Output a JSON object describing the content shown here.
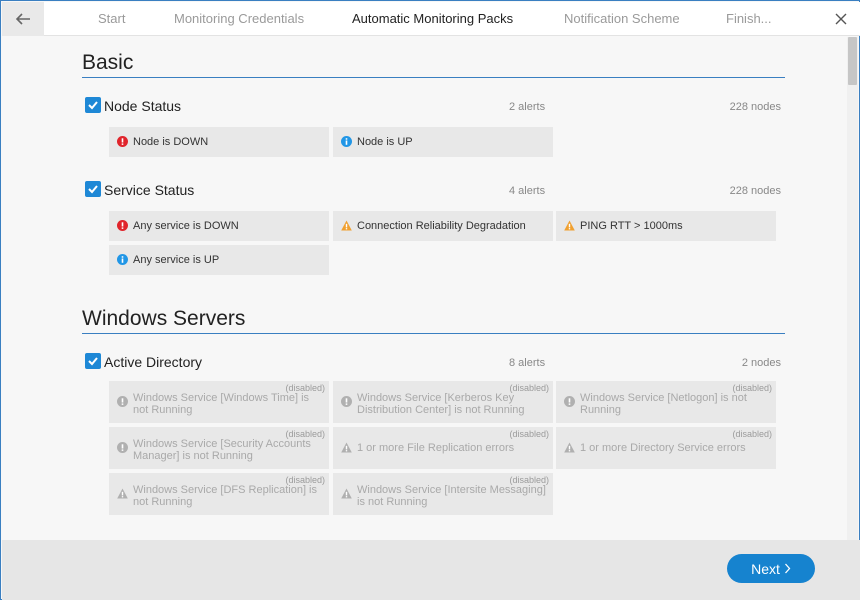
{
  "wizard": {
    "steps": [
      {
        "label": "Start"
      },
      {
        "label": "Monitoring Credentials"
      },
      {
        "label": "Automatic Monitoring Packs"
      },
      {
        "label": "Notification Scheme"
      },
      {
        "label": "Finish..."
      }
    ],
    "active_step": "Automatic Monitoring Packs"
  },
  "sections": [
    {
      "title": "Basic",
      "packs": [
        {
          "name": "Node Status",
          "checked": true,
          "alerts": "2 alerts",
          "nodes": "228 nodes",
          "items": [
            {
              "icon": "error-icon",
              "text": "Node is DOWN"
            },
            {
              "icon": "info-icon",
              "text": "Node is UP"
            }
          ]
        },
        {
          "name": "Service Status",
          "checked": true,
          "alerts": "4 alerts",
          "nodes": "228 nodes",
          "items": [
            {
              "icon": "error-icon",
              "text": "Any service is DOWN"
            },
            {
              "icon": "warning-icon",
              "text": "Connection Reliability Degradation"
            },
            {
              "icon": "warning-icon",
              "text": "PING RTT > 1000ms"
            },
            {
              "icon": "info-icon",
              "text": "Any service is UP"
            }
          ]
        }
      ]
    },
    {
      "title": "Windows Servers",
      "packs": [
        {
          "name": "Active Directory",
          "checked": true,
          "alerts": "8 alerts",
          "nodes": "2 nodes",
          "items": [
            {
              "icon": "disabled-error-icon",
              "text": "Windows Service [Windows Time] is not Running",
              "status": "(disabled)"
            },
            {
              "icon": "disabled-error-icon",
              "text": "Windows Service [Kerberos Key Distribution Center] is not Running",
              "status": "(disabled)"
            },
            {
              "icon": "disabled-error-icon",
              "text": "Windows Service [Netlogon] is not Running",
              "status": "(disabled)"
            },
            {
              "icon": "disabled-error-icon",
              "text": "Windows Service [Security Accounts Manager] is not Running",
              "status": "(disabled)"
            },
            {
              "icon": "disabled-warning-icon",
              "text": "1 or more File Replication errors",
              "status": "(disabled)"
            },
            {
              "icon": "disabled-warning-icon",
              "text": "1 or more Directory Service errors",
              "status": "(disabled)"
            },
            {
              "icon": "disabled-warning-icon",
              "text": "Windows Service [DFS Replication] is not Running",
              "status": "(disabled)"
            },
            {
              "icon": "disabled-warning-icon",
              "text": "Windows Service [Intersite Messaging] is not Running",
              "status": "(disabled)"
            }
          ]
        }
      ]
    }
  ],
  "footer": {
    "next_label": "Next"
  },
  "colors": {
    "accent": "#1683cf",
    "error": "#e0242b",
    "info": "#2196e6",
    "warning": "#f0a030",
    "disabled": "#b0b0b0"
  }
}
